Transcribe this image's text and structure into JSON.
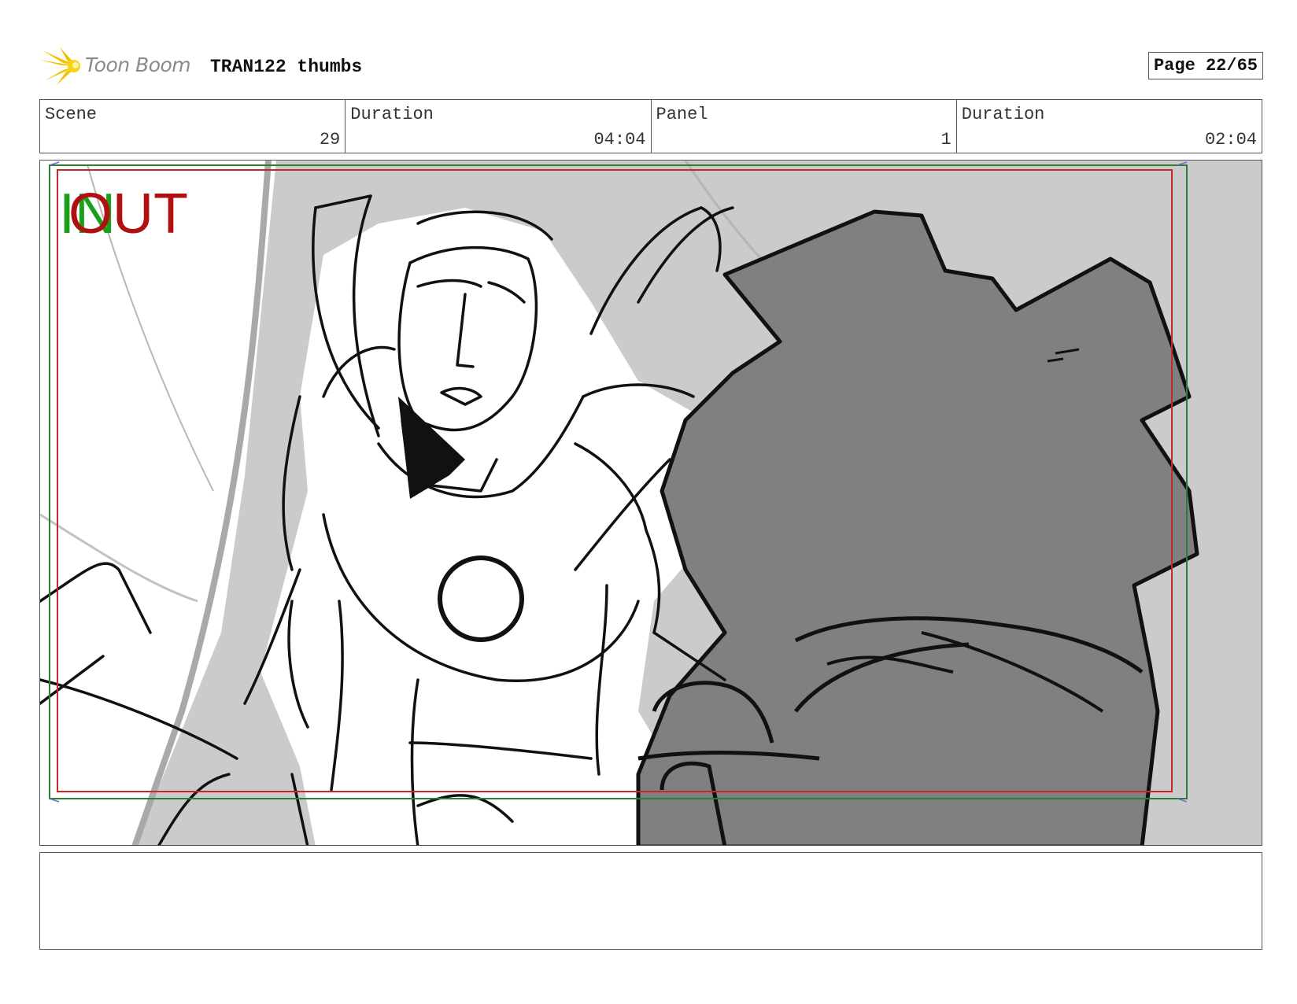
{
  "header": {
    "logo_text": "Toon Boom",
    "title": "TRAN122 thumbs",
    "page": "Page 22/65"
  },
  "info": [
    {
      "label": "Scene",
      "value": "29"
    },
    {
      "label": "Duration",
      "value": "04:04"
    },
    {
      "label": "Panel",
      "value": "1"
    },
    {
      "label": "Duration",
      "value": "02:04"
    }
  ],
  "panel": {
    "in_marker": "IN",
    "out_marker": "OUT",
    "colors": {
      "in": "#1aa01a",
      "out": "#b01010",
      "safe_green": "#2e7d32",
      "safe_red": "#c62828",
      "bg_gray": "#cbcbcb",
      "dark_gray": "#808080"
    }
  },
  "notes": {
    "text": ""
  }
}
